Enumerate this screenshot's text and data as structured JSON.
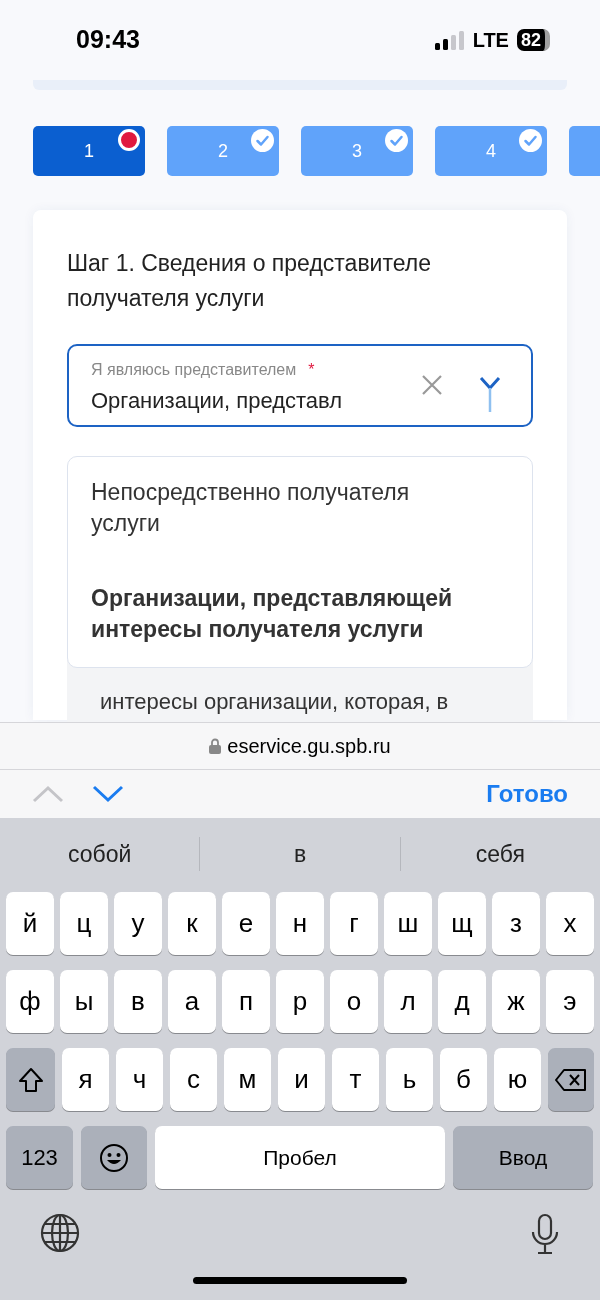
{
  "status_bar": {
    "time": "09:43",
    "network": "LTE",
    "battery": "82"
  },
  "steps": [
    {
      "label": "1",
      "selected": true,
      "kind": "error"
    },
    {
      "label": "2",
      "selected": false,
      "kind": "done"
    },
    {
      "label": "3",
      "selected": false,
      "kind": "done"
    },
    {
      "label": "4",
      "selected": false,
      "kind": "done"
    },
    {
      "selected": false
    }
  ],
  "card": {
    "title": "Шаг 1. Сведения о представителе получателя услуги",
    "field": {
      "label": "Я являюсь представителем",
      "required_mark": "*",
      "value": "Организации, представл",
      "expanded": true
    },
    "options": [
      {
        "label": "Непосредственно получателя услуги",
        "selected": false
      },
      {
        "label": "Организации, представляющей интересы получателя услуги",
        "selected": true
      }
    ],
    "note": "интересы организации, которая, в"
  },
  "address_bar": {
    "url": "eservice.gu.spb.ru"
  },
  "form_toolbar": {
    "prev_disabled": true,
    "next_disabled": false,
    "done": "Готово"
  },
  "keyboard": {
    "suggestions": [
      "собой",
      "в",
      "себя"
    ],
    "letter_rows": [
      {
        "keys": [
          "й",
          "ц",
          "у",
          "к",
          "е",
          "н",
          "г",
          "ш",
          "щ",
          "з",
          "х"
        ]
      },
      {
        "keys": [
          "ф",
          "ы",
          "в",
          "а",
          "п",
          "р",
          "о",
          "л",
          "д",
          "ж",
          "э"
        ]
      },
      {
        "keys": [
          "я",
          "ч",
          "с",
          "м",
          "и",
          "т",
          "ь",
          "б",
          "ю"
        ],
        "with_shift": true
      }
    ],
    "numbers_key": "123",
    "space_key": "Пробел",
    "return_key": "Ввод"
  }
}
